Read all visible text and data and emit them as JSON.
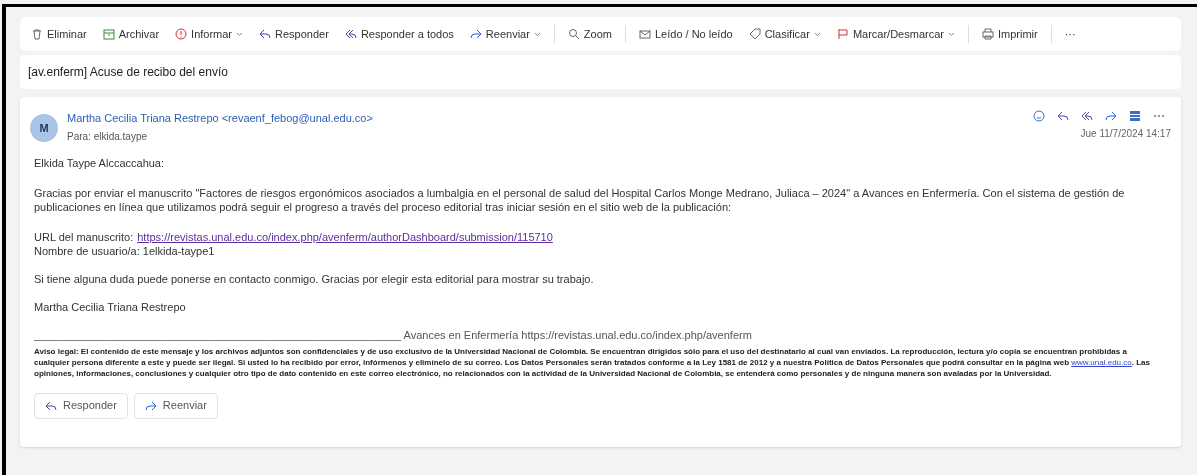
{
  "toolbar": [
    {
      "label": "Eliminar",
      "dropdown": false
    },
    {
      "label": "Archivar",
      "dropdown": false
    },
    {
      "label": "Informar",
      "dropdown": true
    },
    {
      "label": "Responder",
      "dropdown": false
    },
    {
      "label": "Responder a todos",
      "dropdown": false
    },
    {
      "label": "Reenviar",
      "dropdown": true
    },
    {
      "label": "Zoom",
      "dropdown": false
    },
    {
      "label": "Leído / No leído",
      "dropdown": false
    },
    {
      "label": "Clasificar",
      "dropdown": true
    },
    {
      "label": "Marcar/Desmarcar",
      "dropdown": true
    },
    {
      "label": "Imprimir",
      "dropdown": false
    },
    {
      "label": "···",
      "dropdown": false
    }
  ],
  "subject": "[av.enferm] Acuse de recibo del envío",
  "message": {
    "avatar": "M",
    "sender": "Martha Cecilia Triana Restrepo <revaenf_febog@unal.edu.co>",
    "to": "Para:  elkida.taype",
    "date": "Jue 11/7/2024 14:17",
    "greeting": "Elkida Taype Alccaccahua:",
    "paragraph": "Gracias por enviar el manuscrito \"Factores de riesgos ergonómicos asociados a lumbalgia en el personal de salud del Hospital Carlos Monge Medrano, Juliaca – 2024\" a Avances en Enfermería. Con el sistema de gestión de publicaciones en línea que utilizamos podrá seguir el progreso a través del proceso editorial tras iniciar sesión en el sitio web de la publicación:",
    "url_label": "URL del manuscrito:",
    "url": "https://revistas.unal.edu.co/index.php/avenferm/authorDashboard/submission/115710",
    "username": "Nombre de usuario/a: 1elkida-taype1",
    "contact": "Si tiene alguna duda puede ponerse en contacto conmigo. Gracias por elegir esta editorial para mostrar su trabajo.",
    "signature": "Martha Cecilia Triana Restrepo",
    "journal_line": "____________________________________________________________ Avances en Enfermería https://revistas.unal.edu.co/index.php/avenferm",
    "disclaimer_before": "Aviso legal: El contenido de este mensaje y los archivos adjuntos son confidenciales y de uso exclusivo de la Universidad Nacional de Colombia. Se encuentran dirigidos sólo para el uso del destinatario al cual van enviados. La reproducción, lectura y/o copia se encuentran prohibidas a cualquier persona diferente a este y puede ser ilegal. Si usted lo ha recibido por error, infórmenos y elimínelo de su correo. Los Datos Personales serán tratados conforme a la Ley 1581 de 2012 y a nuestra Política de Datos Personales que podrá consultar en la página web ",
    "disclaimer_link": "www.unal.edu.co",
    "disclaimer_after": ". Las opiniones, informaciones, conclusiones y cualquier otro tipo de dato contenido en este correo electrónico, no relacionados con la actividad de la Universidad Nacional de Colombia, se entenderá como personales y de ninguna manera son avaladas por la Universidad.",
    "actions": [
      "Responder",
      "Reenviar"
    ]
  }
}
